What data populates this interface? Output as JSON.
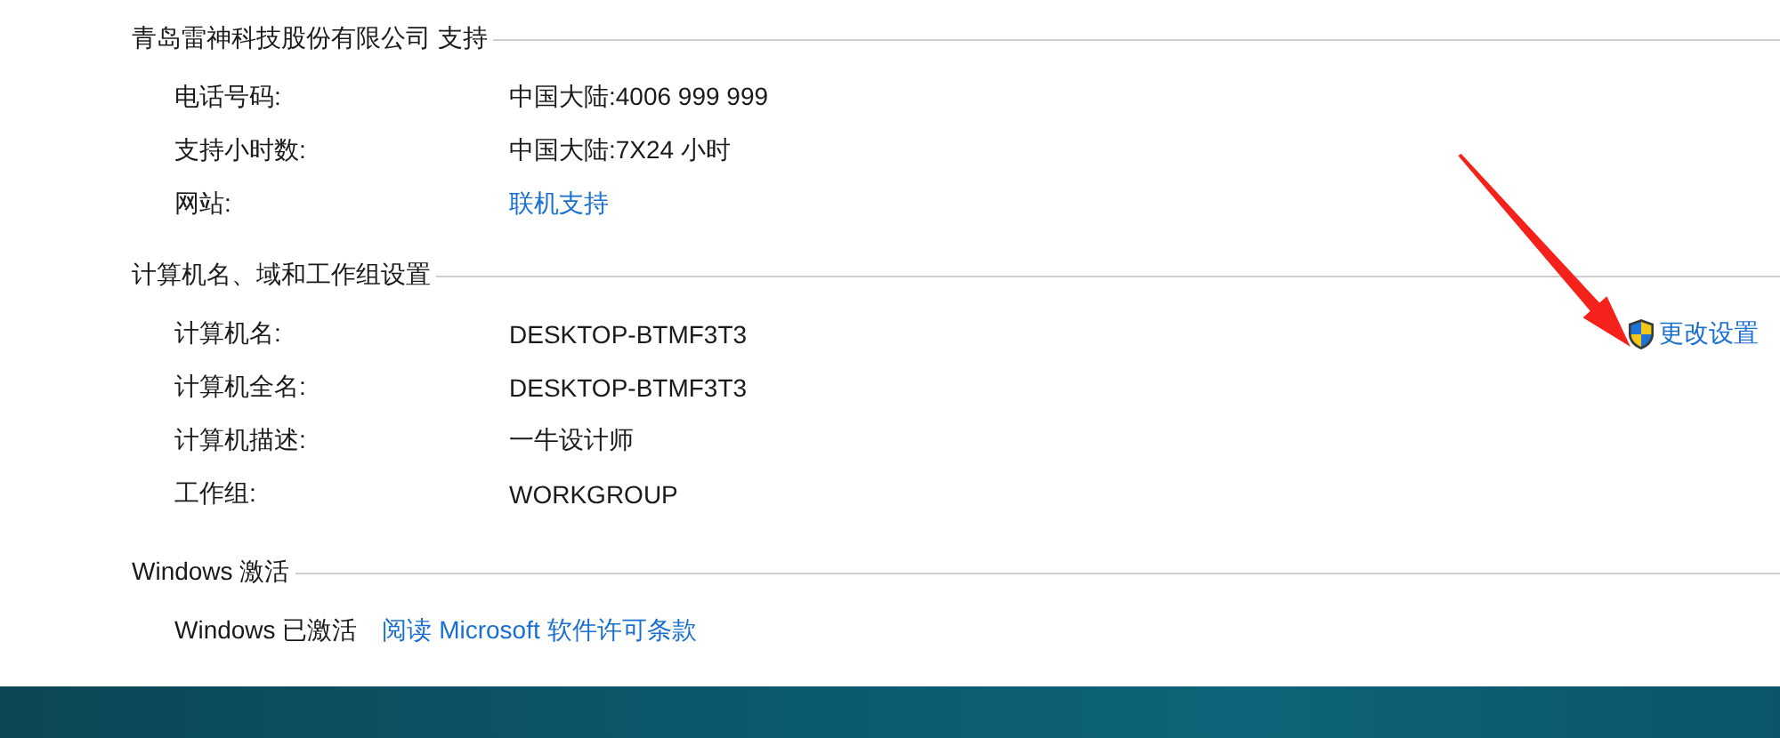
{
  "sections": [
    {
      "kind": "details",
      "title": "青岛雷神科技股份有限公司 支持",
      "rows": [
        {
          "label": "电话号码:",
          "value": "中国大陆:4006 999 999",
          "kind": "text"
        },
        {
          "label": "支持小时数:",
          "value": "中国大陆:7X24 小时",
          "kind": "text"
        },
        {
          "label": "网站:",
          "value": "联机支持",
          "kind": "link"
        }
      ]
    },
    {
      "kind": "details",
      "title": "计算机名、域和工作组设置",
      "action": "更改设置",
      "rows": [
        {
          "label": "计算机名:",
          "value": "DESKTOP-BTMF3T3",
          "kind": "text"
        },
        {
          "label": "计算机全名:",
          "value": "DESKTOP-BTMF3T3",
          "kind": "text"
        },
        {
          "label": "计算机描述:",
          "value": "一牛设计师",
          "kind": "text"
        },
        {
          "label": "工作组:",
          "value": "WORKGROUP",
          "kind": "text"
        }
      ]
    },
    {
      "kind": "activation",
      "title": "Windows 激活",
      "status": "Windows 已激活",
      "link": "阅读 Microsoft 软件许可条款"
    }
  ]
}
